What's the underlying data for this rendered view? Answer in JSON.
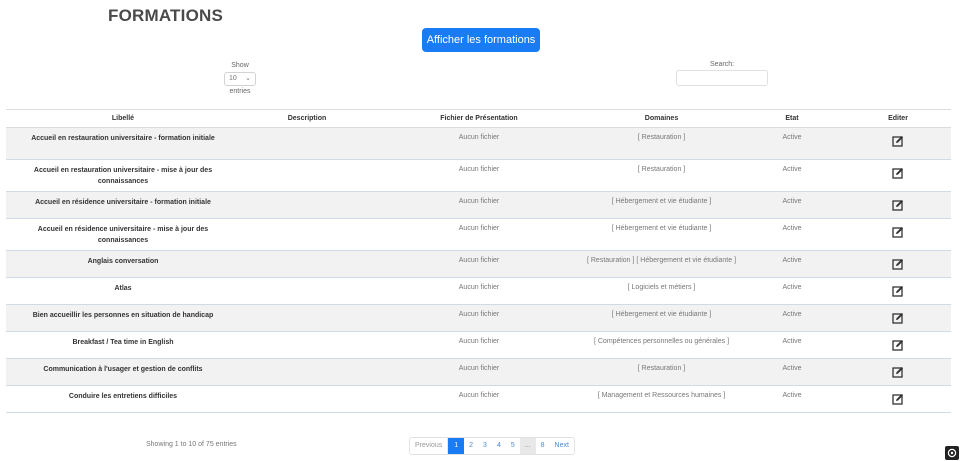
{
  "page": {
    "title": "FORMATIONS",
    "show_button": "Afficher les formations"
  },
  "controls": {
    "show_label": "Show",
    "entries_value": "10",
    "entries_label": "entries",
    "search_label": "Search:"
  },
  "table": {
    "headers": [
      "Libellé",
      "Description",
      "Fichier de Présentation",
      "Domaines",
      "Etat",
      "Editer"
    ],
    "rows": [
      {
        "libelle": "Accueil en restauration universitaire - formation initiale",
        "description": "",
        "fichier": "Aucun fichier",
        "domaines": "[ Restauration ]",
        "etat": "Active"
      },
      {
        "libelle": "Accueil en restauration universitaire - mise à jour des connaissances",
        "description": "",
        "fichier": "Aucun fichier",
        "domaines": "[ Restauration ]",
        "etat": "Active"
      },
      {
        "libelle": "Accueil en résidence universitaire - formation initiale",
        "description": "",
        "fichier": "Aucun fichier",
        "domaines": "[ Hébergement et vie étudiante ]",
        "etat": "Active"
      },
      {
        "libelle": "Accueil en résidence universitaire - mise à jour des connaissances",
        "description": "",
        "fichier": "Aucun fichier",
        "domaines": "[ Hébergement et vie étudiante ]",
        "etat": "Active"
      },
      {
        "libelle": "Anglais conversation",
        "description": "",
        "fichier": "Aucun fichier",
        "domaines": "[ Restauration ] [ Hébergement et vie étudiante ]",
        "etat": "Active"
      },
      {
        "libelle": "Atlas",
        "description": "",
        "fichier": "Aucun fichier",
        "domaines": "[ Logiciels et métiers ]",
        "etat": "Active"
      },
      {
        "libelle": "Bien accueillir les personnes en situation de handicap",
        "description": "",
        "fichier": "Aucun fichier",
        "domaines": "[ Hébergement et vie étudiante ]",
        "etat": "Active"
      },
      {
        "libelle": "Breakfast / Tea time in English",
        "description": "",
        "fichier": "Aucun fichier",
        "domaines": "[ Compétences personnelles ou générales ]",
        "etat": "Active"
      },
      {
        "libelle": "Communication à l'usager et gestion de conflits",
        "description": "",
        "fichier": "Aucun fichier",
        "domaines": "[ Restauration ]",
        "etat": "Active"
      },
      {
        "libelle": "Conduire les entretiens difficiles",
        "description": "",
        "fichier": "Aucun fichier",
        "domaines": "[ Management et Ressources humaines ]",
        "etat": "Active"
      }
    ]
  },
  "footer": {
    "info": "Showing 1 to 10 of 75 entries",
    "pagination": {
      "previous": "Previous",
      "pages": [
        "1",
        "2",
        "3",
        "4",
        "5",
        "...",
        "8"
      ],
      "next": "Next",
      "current": "1"
    }
  },
  "icons": {
    "edit": "edit-icon",
    "corner": "settings-icon"
  },
  "colors": {
    "accent": "#1a7cf5"
  }
}
